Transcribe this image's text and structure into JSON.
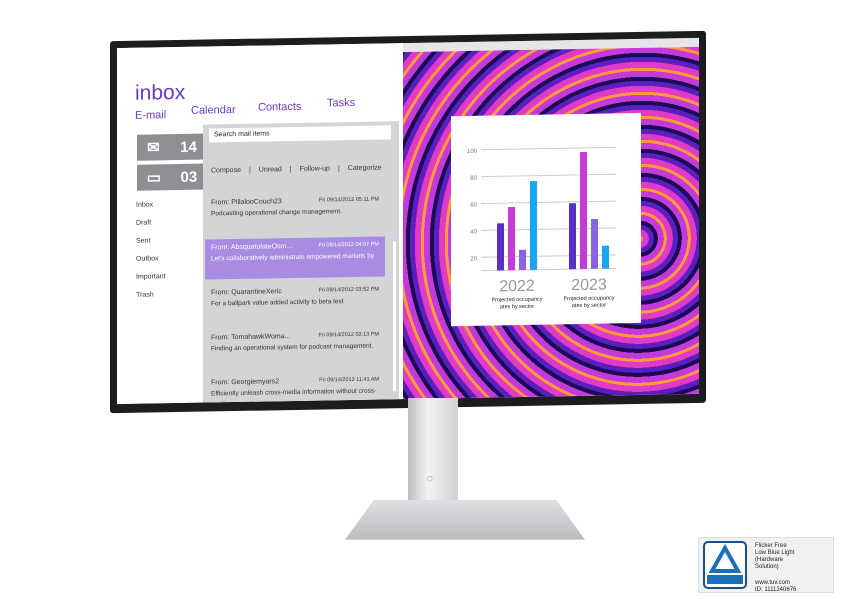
{
  "app": {
    "title": "inbox",
    "nav": [
      "E-mail",
      "Calendar",
      "Contacts",
      "Tasks"
    ]
  },
  "counters": [
    {
      "icon": "envelope-icon",
      "value": "14"
    },
    {
      "icon": "chat-bubble-icon",
      "value": "03"
    }
  ],
  "folders": [
    "Inbox",
    "Draft",
    "Sent",
    "Outbox",
    "Important",
    "Trash"
  ],
  "search": {
    "placeholder": "Search mail items"
  },
  "actions": [
    "Compose",
    "|",
    "Unread",
    "|",
    "Follow-up",
    "|",
    "Categorize"
  ],
  "mails": [
    {
      "from": "From: PillalooCouch23",
      "date": "Fri 09/14/2012 05:11 PM",
      "body": "Podcasting operational change management."
    },
    {
      "from": "From: AbsquatulateOsm...",
      "date": "Fri 09/14/2012 04:07 PM",
      "body": "Let's collaboratively administrate empowered markets by",
      "selected": true
    },
    {
      "from": "From: QuarantineXeric",
      "date": "Fri 09/14/2012 03:52 PM",
      "body": "For a ballpark value added activity to beta test"
    },
    {
      "from": "From: TomahawkWoma...",
      "date": "Fri 09/14/2012 02:13 PM",
      "body": "Finding an operational system for podcast management."
    },
    {
      "from": "From: Georgiemyars2",
      "date": "Fri 09/14/2012 11:41 AM",
      "body": "Efficiently unleash cross-media information without cross-media"
    }
  ],
  "chart_data": {
    "type": "bar",
    "categories": [
      "2022",
      "2023"
    ],
    "category_captions": [
      "Projected occupancy rates by sector",
      "Projected occupancy rates by sector"
    ],
    "series": [
      {
        "values": [
          45,
          59
        ]
      },
      {
        "values": [
          57,
          97
        ]
      },
      {
        "values": [
          25,
          47
        ]
      },
      {
        "values": [
          76,
          27
        ]
      }
    ],
    "colors": [
      "#5a2fc8",
      "#c63ad8",
      "#8a63e0",
      "#16a6f5"
    ],
    "yticks": [
      20,
      40,
      60,
      80,
      100
    ],
    "ylim": [
      10,
      100
    ],
    "grid": true
  },
  "stand": {
    "logo": "DELL"
  },
  "badge": {
    "logo": "TÜVRheinland CERTIFIED",
    "lines": [
      "Flicker Free",
      "Low Blue Light",
      "(Hardware",
      "Solution)"
    ],
    "url": "www.tuv.com",
    "id": "ID: 1111240676"
  }
}
